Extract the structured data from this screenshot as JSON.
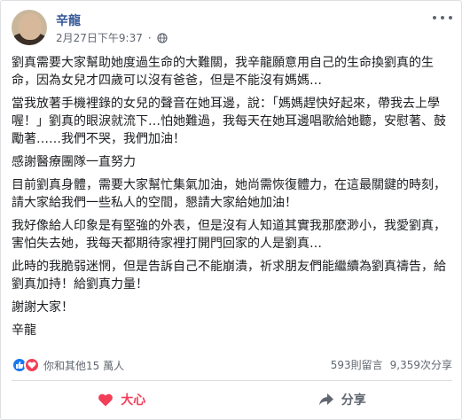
{
  "post": {
    "author": "辛龍",
    "timestamp": "2月27日下午9:37",
    "paragraphs": [
      "劉真需要大家幫助她度過生命的大難關，我辛龍願意用自己的生命換劉真的生命，因為女兒才四歲可以沒有爸爸，但是不能沒有媽媽…",
      "當我放著手機裡錄的女兒的聲音在她耳邊，說：「媽媽趕快好起來，帶我去上學喔！」劉真的眼淚就流下…怕她難過，我每天在她耳邊唱歌給她聽，安慰著、鼓勵著……我們不哭，我們加油！",
      "感謝醫療團隊一直努力",
      "目前劉真身體，需要大家幫忙集氣加油，她尚需恢復體力，在這最關鍵的時刻，請大家給我們一些私人的空間，懇請大家給她加油！",
      "我好像給人印象是有堅強的外表，但是沒有人知道其實我那麼渺小，我愛劉真，害怕失去她，我每天都期待家裡打開門回家的人是劉真…",
      "此時的我脆弱迷惘，但是告訴自己不能崩潰，祈求朋友們能繼續為劉真禱告，給劉真加持！給劉真力量！",
      "謝謝大家！",
      "辛龍"
    ]
  },
  "stats": {
    "reactions_text": "你和其他15 萬人",
    "comments": "593則留言",
    "shares": "9,359次分享"
  },
  "actions": {
    "love_label": "大心",
    "share_label": "分享"
  },
  "colors": {
    "author": "#385898",
    "like": "#1877f2",
    "love": "#f33e58"
  },
  "icons": [
    "globe-icon",
    "more-options-icon",
    "like-reaction-icon",
    "love-reaction-icon",
    "heart-icon",
    "share-arrow-icon"
  ]
}
